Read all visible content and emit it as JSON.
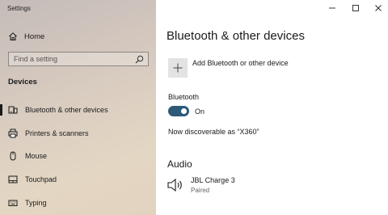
{
  "window": {
    "title": "Settings"
  },
  "sidebar": {
    "home_label": "Home",
    "search_placeholder": "Find a setting",
    "section_header": "Devices",
    "items": [
      {
        "label": "Bluetooth & other devices",
        "icon": "bluetooth-devices-icon",
        "selected": true
      },
      {
        "label": "Printers & scanners",
        "icon": "printer-icon",
        "selected": false
      },
      {
        "label": "Mouse",
        "icon": "mouse-icon",
        "selected": false
      },
      {
        "label": "Touchpad",
        "icon": "touchpad-icon",
        "selected": false
      },
      {
        "label": "Typing",
        "icon": "keyboard-icon",
        "selected": false
      }
    ]
  },
  "main": {
    "title": "Bluetooth & other devices",
    "add_device_label": "Add Bluetooth or other device",
    "bluetooth_label": "Bluetooth",
    "toggle_state": "On",
    "toggle_on": true,
    "discoverable_text": "Now discoverable as “X360”",
    "audio_header": "Audio",
    "audio_devices": [
      {
        "name": "JBL Charge 3",
        "status": "Paired",
        "icon": "speaker-icon"
      }
    ]
  },
  "colors": {
    "accent": "#2c5a78",
    "add_tile": "#e3e3e3"
  }
}
